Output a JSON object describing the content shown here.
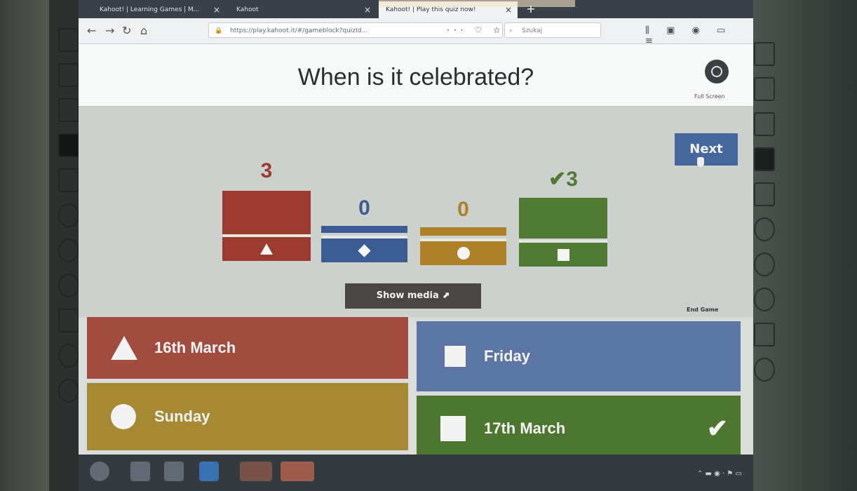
{
  "browser": {
    "tabs": [
      {
        "label": "Kahoot! | Learning Games | M..."
      },
      {
        "label": "Kahoot"
      },
      {
        "label": "Kahoot! | Play this quiz now!"
      }
    ],
    "url": "https://play.kahoot.it/#/gameblock?quizId...",
    "search_placeholder": "Szukaj"
  },
  "game": {
    "question": "When is it celebrated?",
    "fullscreen_label": "Full Screen",
    "next_label": "Next",
    "show_media_label": "Show media",
    "end_game_label": "End Game"
  },
  "results": [
    {
      "count": "3",
      "shape": "triangle",
      "color": "#9b3a2e"
    },
    {
      "count": "0",
      "shape": "diamond",
      "color": "#3b5c93"
    },
    {
      "count": "0",
      "shape": "circle",
      "color": "#ad8128"
    },
    {
      "count": "✔3",
      "shape": "square",
      "color": "#4f7b34",
      "correct": true
    }
  ],
  "answers": [
    {
      "label": "16th March",
      "shape": "triangle",
      "color": "#a24b3f"
    },
    {
      "label": "Friday",
      "shape": "diamond",
      "color": "#5b76a4"
    },
    {
      "label": "Sunday",
      "shape": "circle",
      "color": "#a58a33"
    },
    {
      "label": "17th March",
      "shape": "square",
      "color": "#4d7731",
      "correct": true
    }
  ]
}
